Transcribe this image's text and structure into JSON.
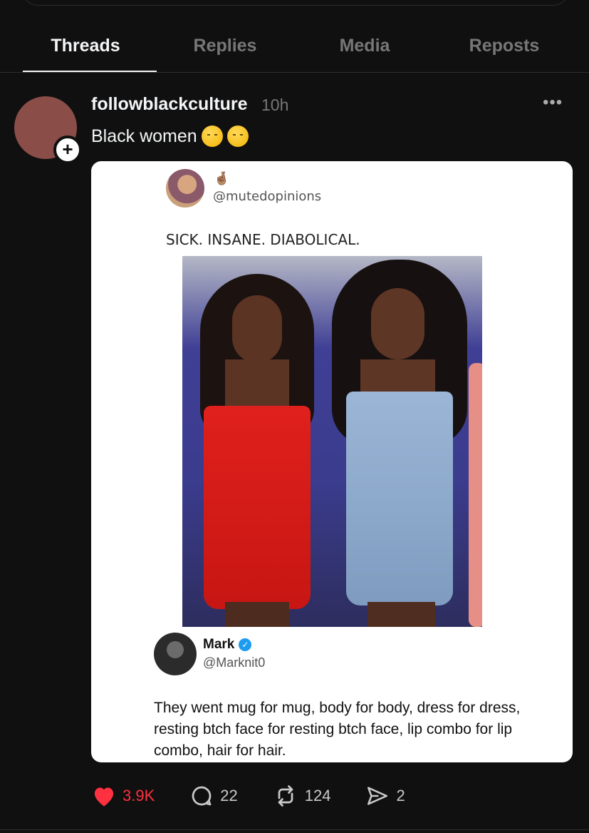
{
  "tabs": [
    {
      "label": "Threads",
      "active": true
    },
    {
      "label": "Replies",
      "active": false
    },
    {
      "label": "Media",
      "active": false
    },
    {
      "label": "Reposts",
      "active": false
    }
  ],
  "post": {
    "username": "followblackculture",
    "time": "10h",
    "text": "Black women",
    "emojis": [
      "face-exhaling",
      "face-exhaling"
    ],
    "more_icon": "more-icon"
  },
  "quoted_tweet": {
    "handle": "@mutedopinions",
    "display_name_emoji": "🤞🏽",
    "caption": "SICK. INSANE. DIABOLICAL.",
    "reply": {
      "name": "Mark",
      "handle": "@Marknit0",
      "text": "They went mug for mug, body for body, dress for dress, resting btch face for resting btch face, lip combo for lip combo, hair for hair."
    }
  },
  "actions": {
    "likes": "3.9K",
    "replies": "22",
    "reposts": "124",
    "shares": "2"
  },
  "colors": {
    "background": "#101010",
    "like": "#ff3040",
    "verified": "#1d9bf0"
  }
}
